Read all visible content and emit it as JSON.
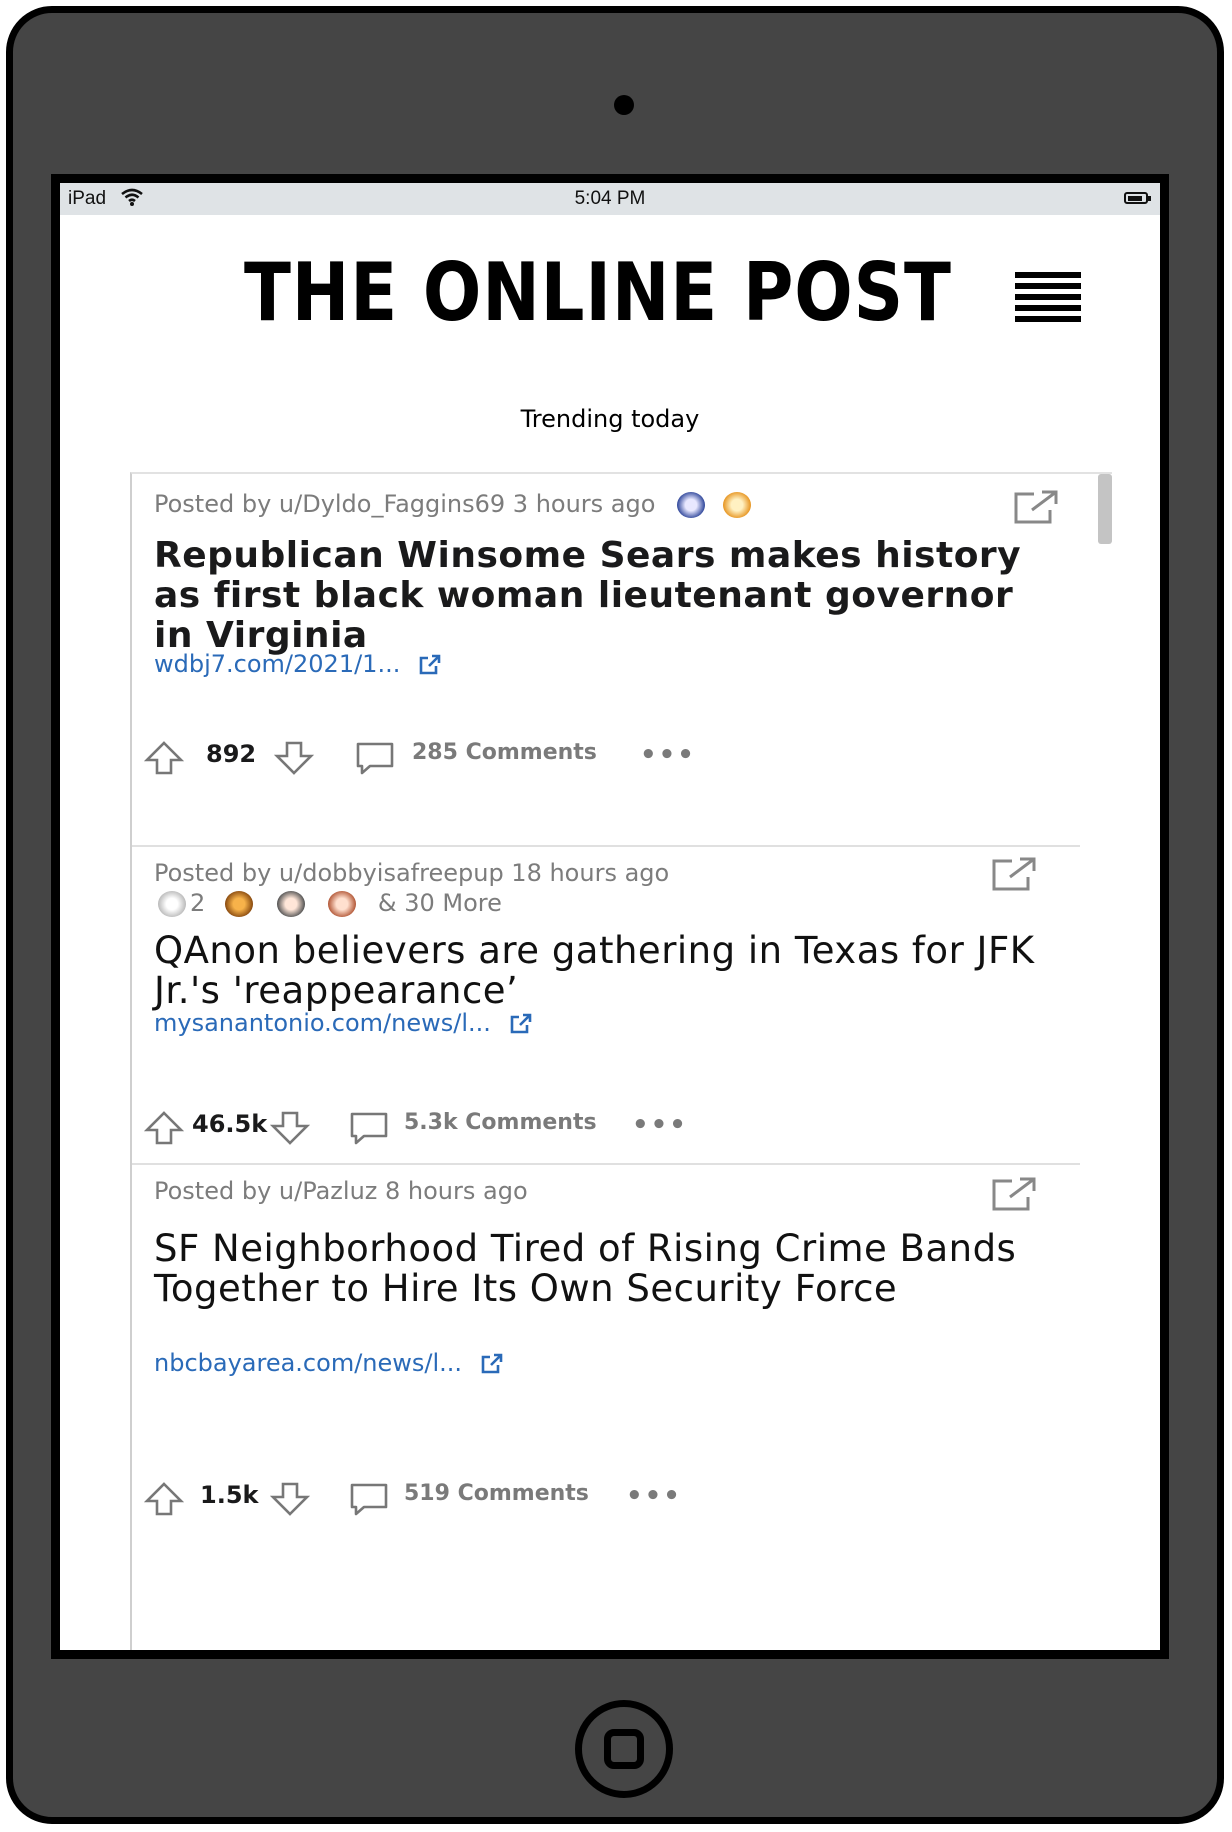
{
  "status_bar": {
    "device": "iPad",
    "time": "5:04 PM"
  },
  "header": {
    "title": "THE ONLINE POST"
  },
  "section": {
    "title": "Trending today"
  },
  "posts": [
    {
      "meta": "Posted by u/Dyldo_Faggins69 3 hours ago",
      "awards_text": "",
      "headline": "Republican Winsome Sears makes history as first black woman lieutenant governor in Virginia",
      "link": "wdbj7.com/2021/1...",
      "votes": "892",
      "comments": "285 Comments"
    },
    {
      "meta": "Posted by u/dobbyisafreepup 18 hours ago",
      "award_count": "2",
      "awards_text": "& 30 More",
      "headline": "QAnon believers are gathering in Texas for JFK Jr.'s 'reappearance’",
      "link": "mysanantonio.com/news/l...",
      "votes": "46.5k",
      "comments": "5.3k Comments"
    },
    {
      "meta": "Posted by u/Pazluz 8 hours ago",
      "awards_text": "",
      "headline": "SF Neighborhood Tired of Rising Crime Bands Together to Hire Its Own Security Force",
      "link": "nbcbayarea.com/news/l...",
      "votes": "1.5k",
      "comments": "519 Comments"
    }
  ],
  "icons": {
    "upvote": "arrow-up-icon",
    "downvote": "arrow-down-icon",
    "comment": "speech-bubble-icon",
    "more": "ellipsis-icon",
    "share": "external-share-icon",
    "menu": "hamburger-menu-icon"
  }
}
